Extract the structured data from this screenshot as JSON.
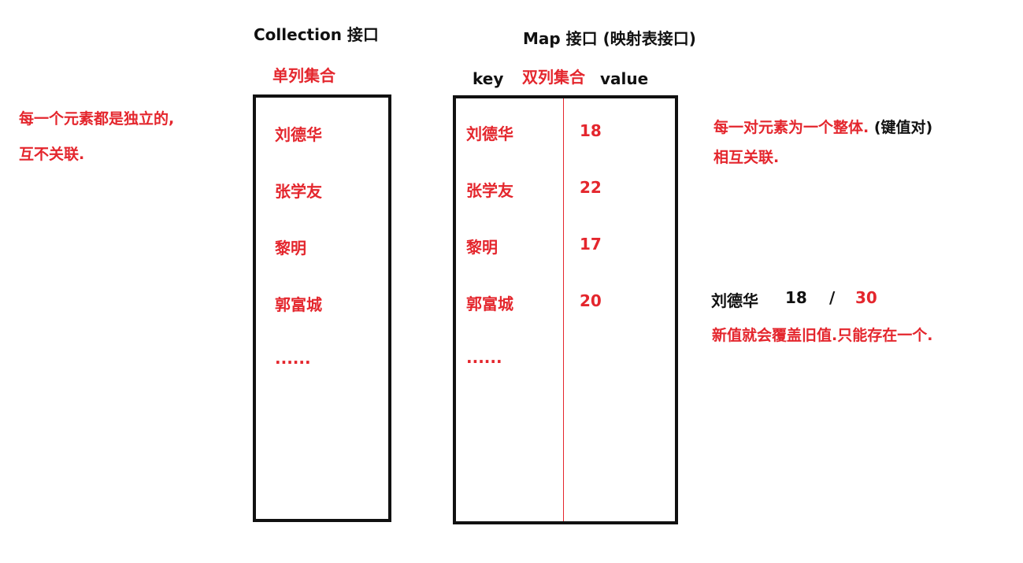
{
  "collection": {
    "title": "Collection 接口",
    "subtitle": "单列集合",
    "items": [
      "刘德华",
      "张学友",
      "黎明",
      "郭富城",
      "......"
    ]
  },
  "map": {
    "title": "Map 接口 (映射表接口)",
    "subtitle": "双列集合",
    "key_header": "key",
    "value_header": "value",
    "keys": [
      "刘德华",
      "张学友",
      "黎明",
      "郭富城",
      "......"
    ],
    "values": [
      "18",
      "22",
      "17",
      "20"
    ]
  },
  "left_note": {
    "line1": "每一个元素都是独立的,",
    "line2": "互不关联."
  },
  "right_note": {
    "line1_red": "每一对元素为一个整体.",
    "line1_black": "(键值对)",
    "line2": "相互关联."
  },
  "override_example": {
    "key": "刘德华",
    "old_value": "18",
    "slash": "/",
    "new_value": "30",
    "explanation": "新值就会覆盖旧值.只能存在一个."
  },
  "colors": {
    "red": "#e4262d",
    "black": "#111111"
  }
}
